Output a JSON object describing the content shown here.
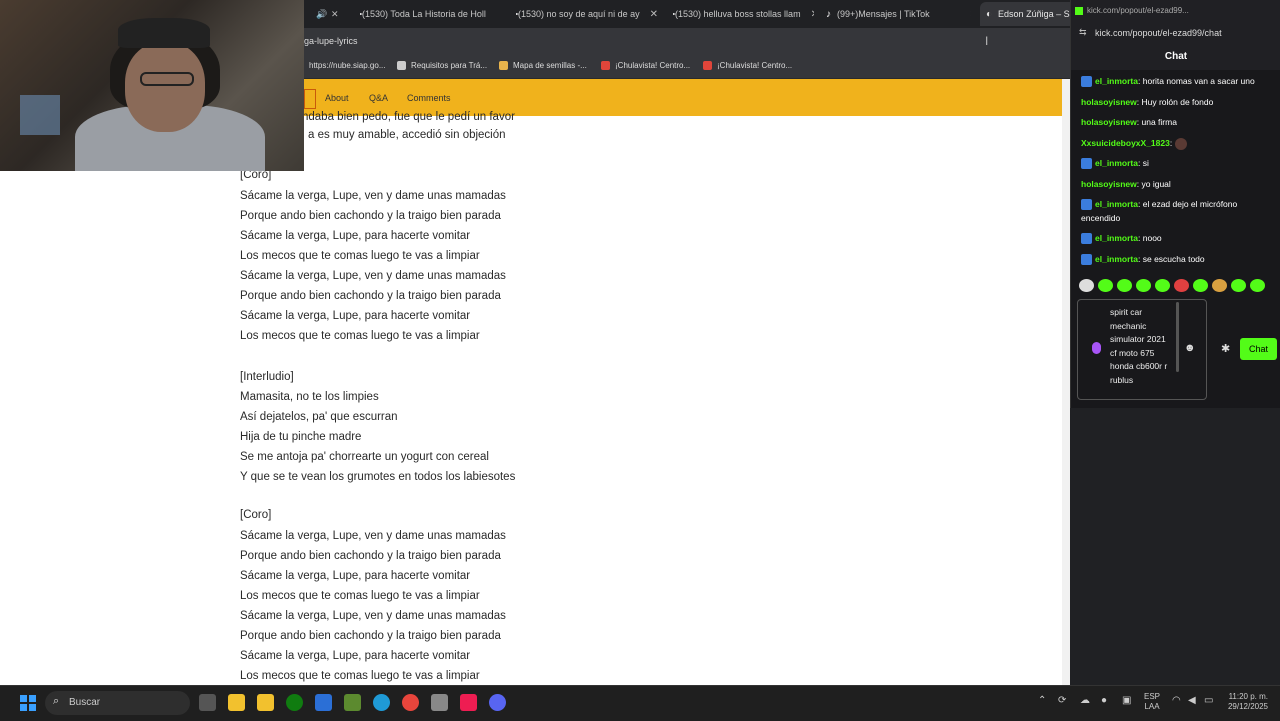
{
  "tabs": [
    {
      "title": "(1530) Toda La Historia de Holl",
      "kind": "youtube"
    },
    {
      "title": "(1530) no soy de aquí ni de ay",
      "kind": "youtube"
    },
    {
      "title": "(1530) helluva boss stollas llam",
      "kind": "youtube"
    },
    {
      "title": "(99+)Mensajes | TikTok",
      "kind": "tiktok"
    },
    {
      "title": "Edson Zúñiga – Sáca",
      "kind": "genius"
    }
  ],
  "address": {
    "url": "ga-lupe-lyrics"
  },
  "bookmarks": [
    "https://nube.siap.go...",
    "Requisitos para Trá...",
    "Mapa de semillas -...",
    "¡Chulavista! Centro...",
    "¡Chulavista! Centro..."
  ],
  "nav": {
    "about": "About",
    "qa": "Q&A",
    "comments": "Comments"
  },
  "lyrics": {
    "top1": "ndaba bien pedo, fue que le pedí un favor",
    "top2": "a es muy amable, accedió sin objeción",
    "coro1": "[Coro]",
    "l1": "Sácame la verga, Lupe, ven y dame unas mamadas",
    "l2": "Porque ando bien cachondo y la traigo bien parada",
    "l3": "Sácame la verga, Lupe, para hacerte vomitar",
    "l4": "Los mecos que te comas luego te vas a limpiar",
    "l5": "Sácame la verga, Lupe, ven y dame unas mamadas",
    "l6": "Porque ando bien cachondo y la traigo bien parada",
    "l7": "Sácame la verga, Lupe, para hacerte vomitar",
    "l8": "Los mecos que te comas luego te vas a limpiar",
    "interludio": "[Interludio]",
    "i1": "Mamasita, no te los limpies",
    "i2": "Así dejatelos, pa' que escurran",
    "i3": "Hija de tu pinche madre",
    "i4": "Se me antoja pa' chorrearte un yogurt con cereal",
    "i5": "Y que se te vean los grumotes en todos los labiesotes",
    "coro2": "[Coro]",
    "m1": "Sácame la verga, Lupe, ven y dame unas mamadas",
    "m2": "Porque ando bien cachondo y la traigo bien parada",
    "m3": "Sácame la verga, Lupe, para hacerte vomitar",
    "m4": "Los mecos que te comas luego te vas a limpiar",
    "m5": "Sácame la verga, Lupe, ven y dame unas mamadas",
    "m6": "Porque ando bien cachondo y la traigo bien parada",
    "m7": "Sácame la verga, Lupe, para hacerte vomitar",
    "m8": "Los mecos que te comas luego te vas a limpiar"
  },
  "chat": {
    "url": "kick.com/popout/el-ezad99/chat",
    "tab_url": "kick.com/popout/el-ezad99...",
    "title": "Chat",
    "messages": [
      {
        "user": "el_inmorta",
        "text": "horita nomas van a sacar uno",
        "badge": true
      },
      {
        "user": "holasoyisnew",
        "text": "Huy rolón de fondo",
        "badge": false
      },
      {
        "user": "holasoyisnew",
        "text": "una firma",
        "badge": false
      },
      {
        "user": "XxsuicideboyxX_1823",
        "text": "",
        "badge": false
      },
      {
        "user": "el_inmorta",
        "text": "si",
        "badge": true
      },
      {
        "user": "holasoyisnew",
        "text": "yo igual",
        "badge": false
      },
      {
        "user": "el_inmorta",
        "text": "el ezad dejo el micrófono encendido",
        "badge": true
      },
      {
        "user": "el_inmorta",
        "text": "nooo",
        "badge": true
      },
      {
        "user": "el_inmorta",
        "text": "se escucha todo",
        "badge": true
      }
    ],
    "input_text": "spirit car mechanic simulator 2021 cf moto 675 honda cb600r r rublus",
    "send_label": "Chat"
  },
  "taskbar": {
    "search_label": "Buscar",
    "lang_line1": "ESP",
    "lang_line2": "LAA",
    "time": "11:20 p. m.",
    "date": "29/12/2025"
  },
  "colors": {
    "accent_yellow": "#f0b21c",
    "kick_green": "#53fc18"
  }
}
